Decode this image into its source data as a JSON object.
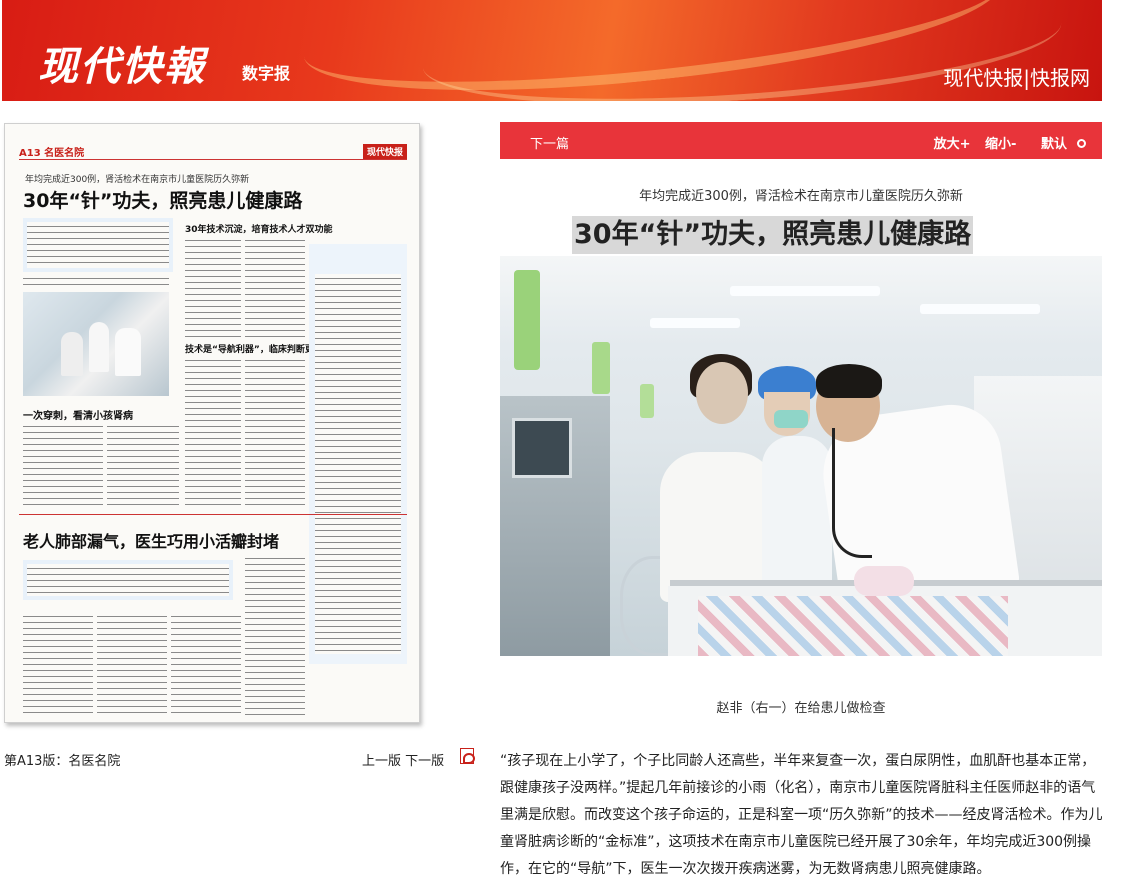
{
  "header": {
    "logo_text": "现代快報",
    "subtag": "数字报",
    "site_link": "现代快报|快报网"
  },
  "newspaper_page": {
    "section_label": "A13 名医名院",
    "masthead": "现代快报",
    "kicker": "年均完成近300例，肾活检术在南京市儿童医院历久弥新",
    "headline": "30年“针”功夫，照亮患儿健康路",
    "subhead_1": "一次穿刺，看清小孩肾病",
    "subhead_2": "30年技术沉淀，培育技术人才双功能",
    "subhead_3": "技术是“导航利器”，临床判断更为关键",
    "headline_2": "老人肺部漏气，医生巧用小活瓣封堵"
  },
  "page_caption": "第A13版：名医名院",
  "page_nav": {
    "prev_label": "上一版",
    "next_label": "下一版"
  },
  "article_toolbar": {
    "next_article": "下一篇",
    "zoom_in": "放大+",
    "zoom_out": "缩小-",
    "reset": "默认"
  },
  "article": {
    "kicker": "年均完成近300例，肾活检术在南京市儿童医院历久弥新",
    "title": "30年“针”功夫，照亮患儿健康路",
    "photo_caption": "赵非（右一）在给患儿做检查",
    "body": "“孩子现在上小学了，个子比同龄人还高些，半年来复查一次，蛋白尿阴性，血肌酐也基本正常，跟健康孩子没两样。”提起几年前接诊的小雨（化名），南京市儿童医院肾脏科主任医师赵非的语气里满是欣慰。而改变这个孩子命运的，正是科室一项“历久弥新”的技术——经皮肾活检术。作为儿童肾脏病诊断的“金标准”，这项技术在南京市儿童医院已经开展了30余年，年均完成近300例操作，在它的“导航”下，医生一次次拨开疾病迷雾，为无数肾病患儿照亮健康路。"
  },
  "colors": {
    "banner_red": "#d81c14",
    "toolbar_red": "#e8343a",
    "section_red": "#c8211a"
  },
  "icons": {
    "pdf": "pdf-icon",
    "reset": "reset-circle-icon"
  }
}
